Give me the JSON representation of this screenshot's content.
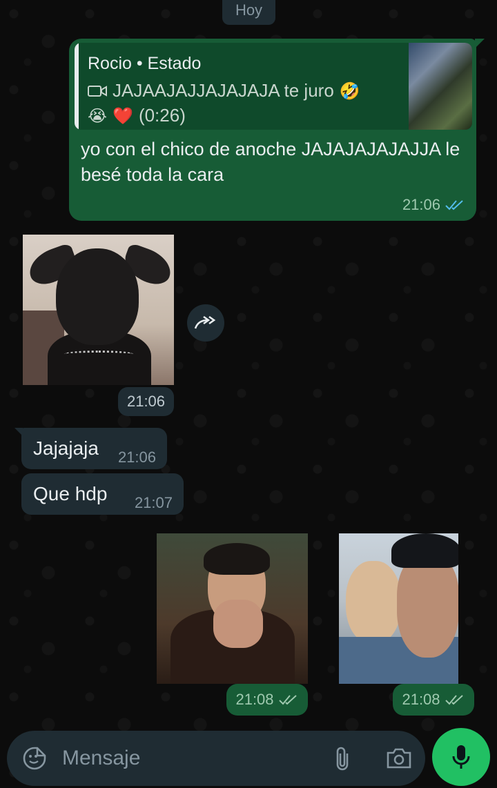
{
  "date_chip": "Hoy",
  "outgoing_reply": {
    "quoted_author": "Rocio • Estado",
    "quoted_text": "JAJAAJAJJAJAJAJA te juro",
    "quoted_emoji_1": "🤣",
    "quoted_emoji_2": "😭",
    "quoted_emoji_3": "❤️",
    "quoted_duration": "(0:26)",
    "message_text": "yo con el chico de anoche JAJAJAJAJAJJA le besé toda la cara",
    "time": "21:06"
  },
  "incoming_sticker_time": "21:06",
  "incoming_messages": [
    {
      "text": "Jajajaja",
      "time": "21:06"
    },
    {
      "text": "Que hdp",
      "time": "21:07"
    }
  ],
  "outgoing_images": [
    {
      "time": "21:08"
    },
    {
      "time": "21:08"
    }
  ],
  "composer": {
    "placeholder": "Mensaje"
  },
  "colors": {
    "outgoing_bubble": "#175c36",
    "incoming_bubble": "#1f2c33",
    "mic_button": "#21c063",
    "read_ticks": "#53bdeb"
  }
}
